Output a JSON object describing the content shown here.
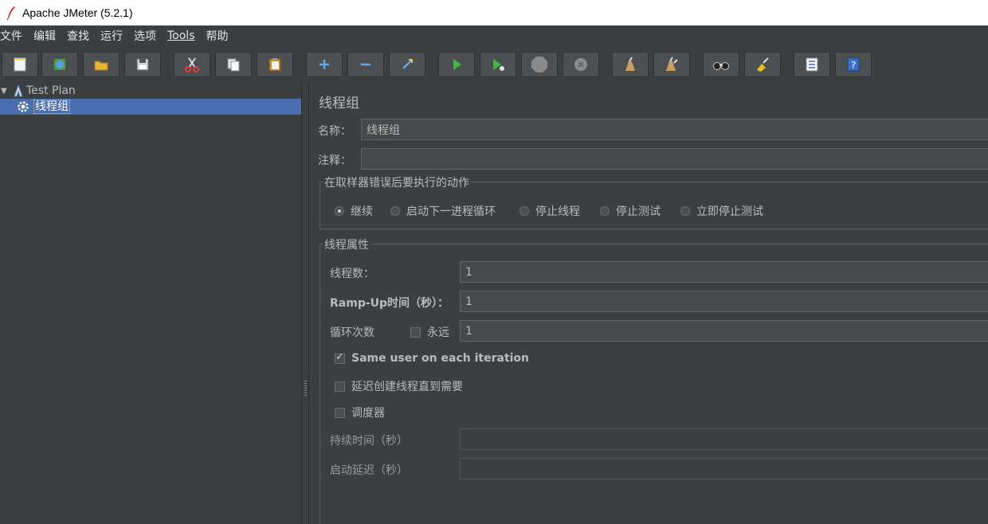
{
  "window": {
    "title": "Apache JMeter (5.2.1)"
  },
  "menu": [
    {
      "label": "文件"
    },
    {
      "label": "编辑"
    },
    {
      "label": "查找"
    },
    {
      "label": "运行"
    },
    {
      "label": "选项"
    },
    {
      "label": "Tools"
    },
    {
      "label": "帮助"
    }
  ],
  "toolbar": [
    {
      "icon": "new-icon"
    },
    {
      "icon": "templates-icon"
    },
    {
      "icon": "open-icon"
    },
    {
      "icon": "save-icon"
    },
    {
      "icon": "cut-icon"
    },
    {
      "icon": "copy-icon"
    },
    {
      "icon": "paste-icon"
    },
    {
      "icon": "expand-icon"
    },
    {
      "icon": "collapse-icon"
    },
    {
      "icon": "toggle-icon"
    },
    {
      "icon": "start-icon"
    },
    {
      "icon": "start-no-pause-icon"
    },
    {
      "icon": "stop-icon"
    },
    {
      "icon": "shutdown-icon"
    },
    {
      "icon": "clear-icon"
    },
    {
      "icon": "clear-all-icon"
    },
    {
      "icon": "search-icon"
    },
    {
      "icon": "reset-search-icon"
    },
    {
      "icon": "function-helper-icon"
    },
    {
      "icon": "help-icon"
    }
  ],
  "tree": {
    "root": {
      "label": "Test Plan"
    },
    "child": {
      "label": "线程组"
    }
  },
  "panel": {
    "title": "线程组",
    "name_label": "名称：",
    "name_value": "线程组",
    "comment_label": "注释：",
    "comment_value": "",
    "error_action": {
      "title": "在取样器错误后要执行的动作",
      "options": [
        "继续",
        "启动下一进程循环",
        "停止线程",
        "停止测试",
        "立即停止测试"
      ],
      "selected": "继续"
    },
    "thread_props": {
      "title": "线程属性",
      "threads_label": "线程数：",
      "threads_value": "1",
      "rampup_label": "Ramp-Up时间（秒）：",
      "rampup_value": "1",
      "loop_label": "循环次数",
      "forever_label": "永远",
      "forever_checked": false,
      "loop_value": "1",
      "same_user_label": "Same user on each iteration",
      "same_user_checked": true,
      "delay_label": "延迟创建线程直到需要",
      "delay_checked": false,
      "scheduler_label": "调度器",
      "scheduler_checked": false,
      "duration_label": "持续时间（秒）",
      "duration_value": "",
      "startup_delay_label": "启动延迟（秒）",
      "startup_delay_value": ""
    }
  },
  "colors": {
    "background": "#3c3f41",
    "selection": "#4b6eaf",
    "field": "#45494a"
  }
}
